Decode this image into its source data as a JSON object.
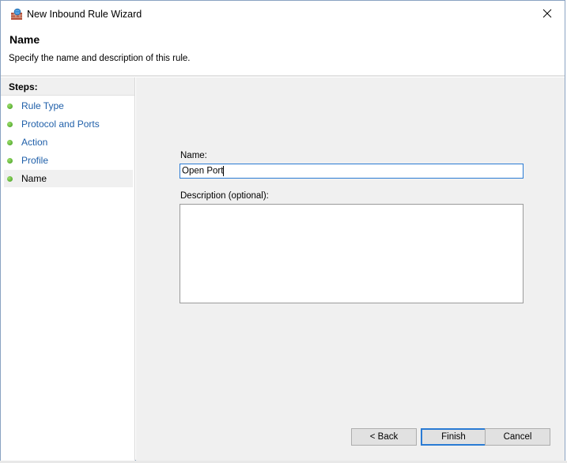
{
  "window": {
    "title": "New Inbound Rule Wizard"
  },
  "header": {
    "title": "Name",
    "description": "Specify the name and description of this rule."
  },
  "steps": {
    "heading": "Steps:",
    "items": [
      {
        "label": "Rule Type",
        "state": "completed"
      },
      {
        "label": "Protocol and Ports",
        "state": "completed"
      },
      {
        "label": "Action",
        "state": "completed"
      },
      {
        "label": "Profile",
        "state": "completed"
      },
      {
        "label": "Name",
        "state": "current"
      }
    ]
  },
  "form": {
    "name_label": "Name:",
    "name_value": "Open Port",
    "description_label": "Description (optional):",
    "description_value": ""
  },
  "buttons": {
    "back": "< Back",
    "finish": "Finish",
    "cancel": "Cancel"
  },
  "colors": {
    "step_link": "#1f5fa9",
    "focus_border": "#2a7bd4",
    "step_dot": "#3e9a1e",
    "content_bg": "#f0f0f0"
  },
  "icons": {
    "title": "firewall-icon",
    "close": "close-icon",
    "step": "green-dot-icon"
  }
}
